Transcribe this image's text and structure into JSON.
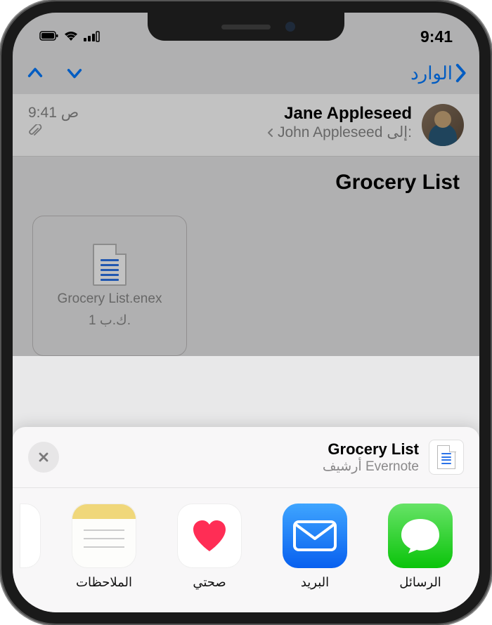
{
  "status": {
    "time": "9:41"
  },
  "nav": {
    "back_label": "الوارد"
  },
  "email": {
    "sender": "Jane Appleseed",
    "to_label": "إلى:",
    "recipient": "John Appleseed",
    "time": "9:41 ص",
    "subject": "Grocery List",
    "attachment_name": "Grocery List.enex",
    "attachment_size": "1 ك.ب."
  },
  "share": {
    "title": "Grocery List",
    "subtitle": "أرشيف Evernote",
    "apps": [
      {
        "label": "الرسائل",
        "icon": "messages"
      },
      {
        "label": "البريد",
        "icon": "mail"
      },
      {
        "label": "صحتي",
        "icon": "health"
      },
      {
        "label": "الملاحظات",
        "icon": "notes"
      }
    ]
  }
}
